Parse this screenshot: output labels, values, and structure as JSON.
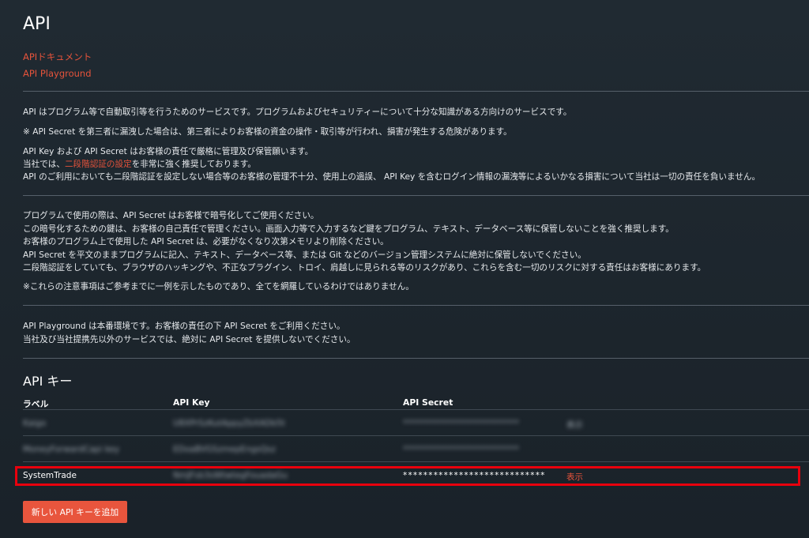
{
  "header": {
    "title": "API",
    "links": [
      "APIドキュメント",
      "API Playground"
    ]
  },
  "notice1": {
    "line1": "API はプログラム等で自動取引等を行うためのサービスです。プログラムおよびセキュリティーについて十分な知識がある方向けのサービスです。",
    "line2": "※ API Secret を第三者に漏洩した場合は、第三者によりお客様の資金の操作・取引等が行われ、損害が発生する危険があります。",
    "line3": "API Key および API Secret はお客様の責任で厳格に管理及び保管願います。",
    "line4_pre": "当社では、",
    "line4_link": "二段階認証の設定",
    "line4_post": "を非常に強く推奨しております。",
    "line5": "API のご利用においても二段階認証を設定しない場合等のお客様の管理不十分、使用上の過誤、 API Key を含むログイン情報の漏洩等によるいかなる損害について当社は一切の責任を負いません。"
  },
  "notice2": {
    "line1": "プログラムで使用の際は、API Secret はお客様で暗号化してご使用ください。",
    "line2": "この暗号化するための鍵は、お客様の自己責任で管理ください。画面入力等で入力するなど鍵をプログラム、テキスト、データベース等に保管しないことを強く推奨します。",
    "line3": "お客様のプログラム上で使用した API Secret は、必要がなくなり次第メモリより削除ください。",
    "line4": "API Secret を平文のままプログラムに記入、テキスト、データベース等、または Git などのバージョン管理システムに絶対に保管しないでください。",
    "line5": "二段階認証をしていても、ブラウザのハッキングや、不正なプラグイン、トロイ、肩越しに見られる等のリスクがあり、これらを含む一切のリスクに対する責任はお客様にあります。",
    "line6": "※これらの注意事項はご参考までに一例を示したものであり、全てを網羅しているわけではありません。"
  },
  "notice3": {
    "line1": "API Playground は本番環境です。お客様の責任の下 API Secret をご利用ください。",
    "line2": "当社及び当社提携先以外のサービスでは、絶対に API Secret を提供しないでください。"
  },
  "api_keys": {
    "heading": "API キー",
    "columns": [
      "ラベル",
      "API Key",
      "API Secret"
    ],
    "rows": [
      {
        "label": "Kaigo",
        "key": "U8XPrSzKutAppyZbXADb5t",
        "secret": "****************************",
        "action": "表示"
      },
      {
        "label": "MoneyForwardCapi key",
        "key": "EDoaBVGSzmepEngsQsz",
        "secret": "****************************",
        "action": ""
      },
      {
        "label": "SystemTrade",
        "key": "NmJFsb3sWtwtegFouadaGu",
        "secret": "****************************",
        "action": "表示"
      }
    ],
    "add_button": "新しい API キーを追加"
  },
  "colors": {
    "accent": "#e5533b",
    "highlight_border": "#e8000d",
    "background": "#1f282f"
  }
}
